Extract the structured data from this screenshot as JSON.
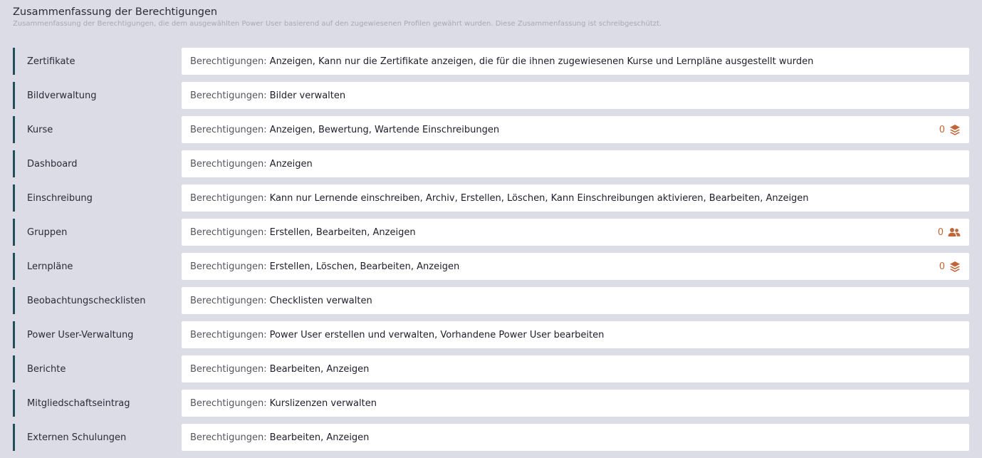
{
  "header": {
    "title": "Zusammenfassung der Berechtigungen",
    "subtitle": "Zusammenfassung der Berechtigungen, die dem ausgewählten Power User basierend auf den zugewiesenen Profilen gewährt wurden. Diese Zusammenfassung ist schreibgeschützt."
  },
  "prefix": "Berechtigungen:",
  "rows": [
    {
      "label": "Zertifikate",
      "value": "Anzeigen, Kann nur die Zertifikate anzeigen, die für die ihnen zugewiesenen Kurse und Lernpläne ausgestellt wurden"
    },
    {
      "label": "Bildverwaltung",
      "value": "Bilder verwalten"
    },
    {
      "label": "Kurse",
      "value": "Anzeigen, Bewertung, Wartende Einschreibungen",
      "badge": {
        "count": "0",
        "icon": "layers-icon"
      }
    },
    {
      "label": "Dashboard",
      "value": "Anzeigen"
    },
    {
      "label": "Einschreibung",
      "value": "Kann nur Lernende einschreiben, Archiv, Erstellen, Löschen, Kann Einschreibungen aktivieren, Bearbeiten, Anzeigen"
    },
    {
      "label": "Gruppen",
      "value": "Erstellen, Bearbeiten, Anzeigen",
      "badge": {
        "count": "0",
        "icon": "users-icon"
      }
    },
    {
      "label": "Lernpläne",
      "value": "Erstellen, Löschen, Bearbeiten, Anzeigen",
      "badge": {
        "count": "0",
        "icon": "layers-icon"
      }
    },
    {
      "label": "Beobachtungschecklisten",
      "value": "Checklisten verwalten"
    },
    {
      "label": "Power User-Verwaltung",
      "value": "Power User erstellen und verwalten, Vorhandene Power User bearbeiten"
    },
    {
      "label": "Berichte",
      "value": "Bearbeiten, Anzeigen"
    },
    {
      "label": "Mitgliedschaftseintrag",
      "value": "Kurslizenzen verwalten"
    },
    {
      "label": "Externen Schulungen",
      "value": "Bearbeiten, Anzeigen"
    }
  ],
  "colors": {
    "accent_border": "#1f4f5f",
    "badge": "#c0673a",
    "background": "#dcdce6"
  }
}
